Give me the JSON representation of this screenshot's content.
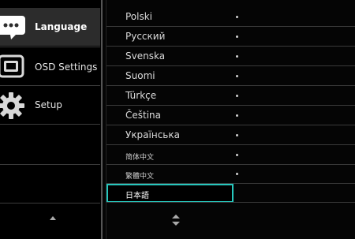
{
  "sidebar": {
    "items": [
      {
        "label": "Language",
        "icon": "language-bubble-icon",
        "selected": true
      },
      {
        "label": "OSD Settings",
        "icon": "osd-settings-icon",
        "selected": false
      },
      {
        "label": "Setup",
        "icon": "gear-icon",
        "selected": false
      }
    ]
  },
  "languages": [
    {
      "label": "Polski"
    },
    {
      "label": "Русский"
    },
    {
      "label": "Svenska"
    },
    {
      "label": "Suomi"
    },
    {
      "label": "Türkçe"
    },
    {
      "label": "Čeština"
    },
    {
      "label": "Українська"
    },
    {
      "label": "简体中文"
    },
    {
      "label": "繁體中文"
    },
    {
      "label": "日本語",
      "selected": true
    }
  ],
  "colors": {
    "highlight": "#27c7bd",
    "selected_bg": "#2c2c2c"
  }
}
